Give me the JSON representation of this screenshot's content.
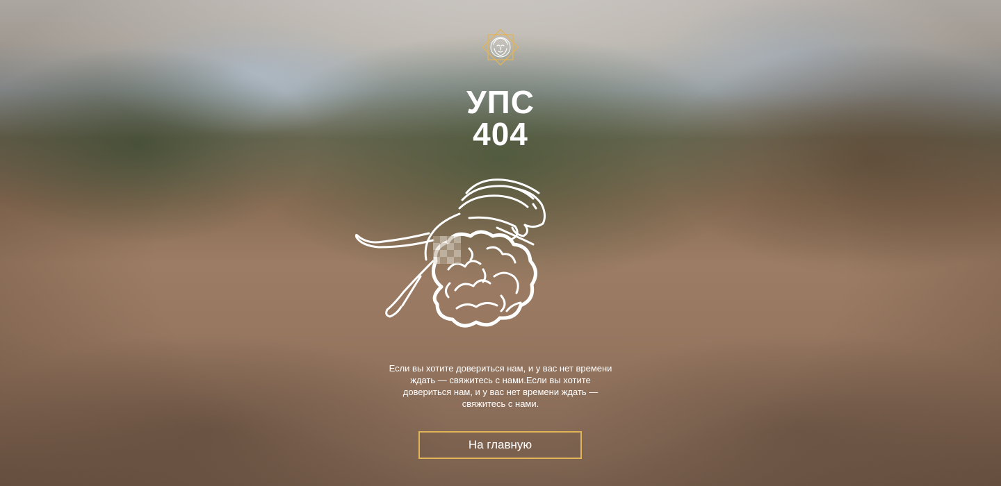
{
  "header": {
    "logo_icon": "lion-head-logo-icon"
  },
  "error": {
    "title_line1": "УПС",
    "title_line2": "404",
    "illustration_icon": "lion-jumping-over-brain-icon",
    "description": "Если вы хотите довериться нам, и у вас нет времени ждать — свяжитесь с нами.Если вы хотите довериться нам, и у вас нет времени ждать — свяжитесь с нами."
  },
  "actions": {
    "home_label": "На главную"
  },
  "colors": {
    "accent": "#e2b45a",
    "text": "#ffffff"
  }
}
